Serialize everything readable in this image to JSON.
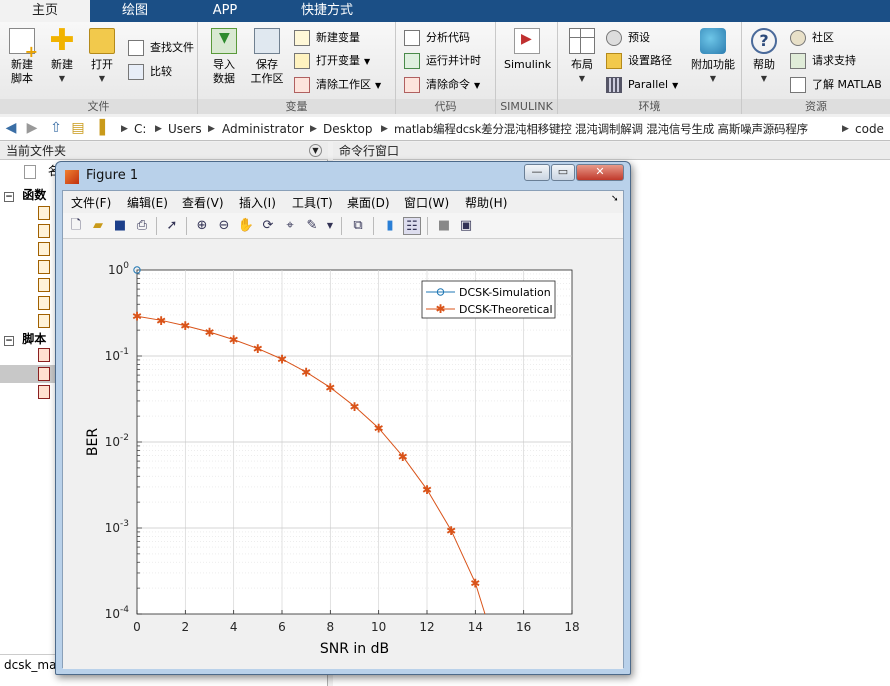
{
  "ribbon": {
    "tabs": [
      "主页",
      "绘图",
      "APP",
      "快捷方式"
    ],
    "groups": {
      "file": {
        "label": "文件",
        "new_script": [
          "新建",
          "脚本"
        ],
        "new": "新建",
        "open": "打开",
        "find_files": "查找文件",
        "compare": "比较"
      },
      "variable": {
        "label": "变量",
        "import": [
          "导入",
          "数据"
        ],
        "save_workspace": [
          "保存",
          "工作区"
        ],
        "new_variable": "新建变量",
        "open_variable": "打开变量",
        "clear_workspace": "清除工作区"
      },
      "code": {
        "label": "代码",
        "analyze": "分析代码",
        "run_time": "运行并计时",
        "clear_commands": "清除命令"
      },
      "simulink": {
        "label": "SIMULINK",
        "simulink": "Simulink"
      },
      "environment": {
        "label": "环境",
        "layout": "布局",
        "preferences": "预设",
        "set_path": "设置路径",
        "parallel": "Parallel",
        "addons": "附加功能"
      },
      "resources": {
        "label": "资源",
        "help": "帮助",
        "community": "社区",
        "request_support": "请求支持",
        "learn_matlab": "了解 MATLAB"
      }
    }
  },
  "address": {
    "crumbs": [
      "C:",
      "Users",
      "Administrator",
      "Desktop",
      "matlab编程dcsk差分混沌相移键控 混沌调制解调 混沌信号生成 高斯噪声源码程序",
      "code"
    ]
  },
  "panels": {
    "current_folder": "当前文件夹",
    "command_window": "命令行窗口",
    "name_col": "名",
    "functions": "函数",
    "scripts": "脚本",
    "bottom_file": "dcsk_ma"
  },
  "figure": {
    "title": "Figure 1",
    "menus": [
      "文件(F)",
      "编辑(E)",
      "查看(V)",
      "插入(I)",
      "工具(T)",
      "桌面(D)",
      "窗口(W)",
      "帮助(H)"
    ]
  },
  "chart_data": {
    "type": "line",
    "xlabel": "SNR in dB",
    "ylabel": "BER",
    "xlim": [
      0,
      18
    ],
    "ylim": [
      0.0001,
      1
    ],
    "yscale": "log",
    "xticks": [
      0,
      2,
      4,
      6,
      8,
      10,
      12,
      14,
      16,
      18
    ],
    "ytick_exponents": [
      0,
      -1,
      -2,
      -3,
      -4
    ],
    "grid": true,
    "legend_position": "top-right",
    "series": [
      {
        "name": "DCSK-Simulation",
        "color": "#1f77b4",
        "marker": "circle",
        "x": [
          0
        ],
        "y": [
          1
        ]
      },
      {
        "name": "DCSK-Theoretical",
        "color": "#d95319",
        "marker": "asterisk",
        "x": [
          0,
          1,
          2,
          3,
          4,
          5,
          6,
          7,
          8,
          9,
          10,
          11,
          12,
          13,
          14,
          14.4
        ],
        "y": [
          0.29,
          0.26,
          0.225,
          0.19,
          0.155,
          0.122,
          0.092,
          0.065,
          0.043,
          0.026,
          0.0145,
          0.0068,
          0.0028,
          0.00094,
          0.00023,
          0.0001
        ]
      }
    ]
  }
}
